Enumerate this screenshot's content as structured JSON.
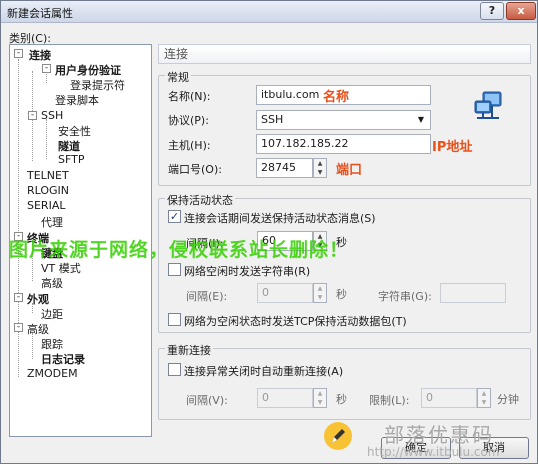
{
  "window": {
    "title": "新建会话属性",
    "help": "?",
    "close": "x"
  },
  "category_label": "类别(C):",
  "tree": [
    {
      "label": "连接",
      "bold": true,
      "expander": "-"
    },
    {
      "label": "用户身份验证",
      "bold": true,
      "expander": "-"
    },
    {
      "label": "登录提示符",
      "bold": false
    },
    {
      "label": "登录脚本",
      "bold": false
    },
    {
      "label": "SSH",
      "bold": false,
      "expander": "-"
    },
    {
      "label": "安全性",
      "bold": false
    },
    {
      "label": "隧道",
      "bold": true
    },
    {
      "label": "SFTP",
      "bold": false
    },
    {
      "label": "TELNET",
      "bold": false
    },
    {
      "label": "RLOGIN",
      "bold": false
    },
    {
      "label": "SERIAL",
      "bold": false
    },
    {
      "label": "代理",
      "bold": false
    },
    {
      "label": "终端",
      "bold": true,
      "expander": "-"
    },
    {
      "label": "键盘",
      "bold": true
    },
    {
      "label": "VT 模式",
      "bold": false
    },
    {
      "label": "高级",
      "bold": false
    },
    {
      "label": "外观",
      "bold": true,
      "expander": "-"
    },
    {
      "label": "边距",
      "bold": false
    },
    {
      "label": "高级",
      "bold": false,
      "expander": "-"
    },
    {
      "label": "跟踪",
      "bold": false
    },
    {
      "label": "日志记录",
      "bold": true
    },
    {
      "label": "ZMODEM",
      "bold": false
    }
  ],
  "panel": {
    "header": "连接"
  },
  "general": {
    "title": "常规",
    "name_label": "名称(N):",
    "name_value": "itbulu.com",
    "name_note": "名称",
    "protocol_label": "协议(P):",
    "protocol_value": "SSH",
    "host_label": "主机(H):",
    "host_value": "107.182.185.22",
    "host_note": "IP地址",
    "port_label": "端口号(O):",
    "port_value": "28745",
    "port_note": "端口"
  },
  "keepalive": {
    "title": "保持活动状态",
    "send_msg_label": "连接会话期间发送保持活动状态消息(S)",
    "send_msg_checked": true,
    "interval_label": "间隔(I):",
    "interval_value": "60",
    "seconds": "秒",
    "idle_str_label": "网络空闲时发送字符串(R)",
    "idle_str_checked": false,
    "interval2_label": "间隔(E):",
    "interval2_value": "0",
    "seconds2": "秒",
    "string_label": "字符串(G):",
    "tcp_label": "网络为空闲状态时发送TCP保持活动数据包(T)",
    "tcp_checked": false
  },
  "reconnect": {
    "title": "重新连接",
    "auto_label": "连接异常关闭时自动重新连接(A)",
    "auto_checked": false,
    "interval_label": "间隔(V):",
    "interval_value": "0",
    "seconds": "秒",
    "limit_label": "限制(L):",
    "limit_value": "0",
    "minutes": "分钟"
  },
  "overlay": {
    "notice": "图片来源于网络，侵权联系站长删除！"
  },
  "buttons": {
    "ok": "确定",
    "cancel": "取消"
  },
  "watermark": {
    "text": "部落优惠码",
    "url": "http://www.itbulu.com"
  }
}
